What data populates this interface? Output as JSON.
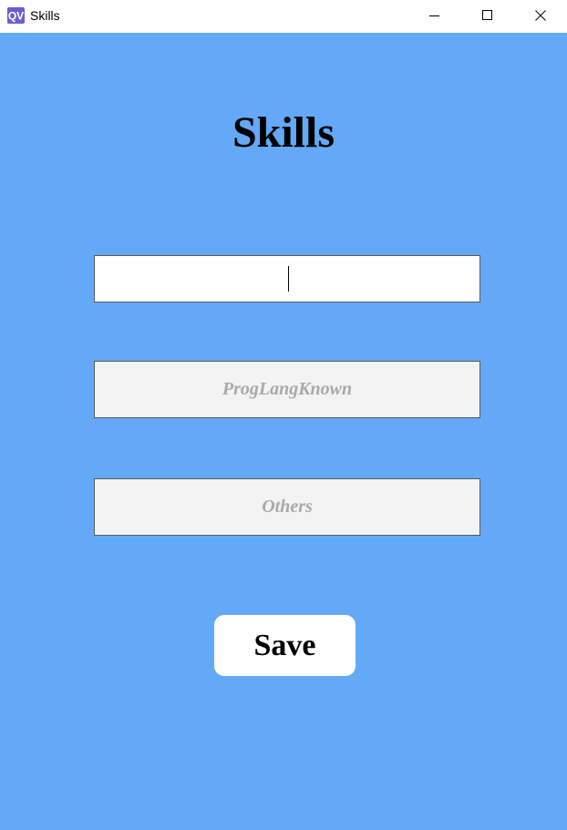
{
  "window": {
    "title": "Skills",
    "icon": "app-icon",
    "controls": [
      "minimize-icon",
      "maximize-icon",
      "close-icon"
    ]
  },
  "form": {
    "heading": "Skills",
    "fields": [
      {
        "value": "",
        "placeholder": ""
      },
      {
        "value": "",
        "placeholder": "ProgLangKnown"
      },
      {
        "value": "",
        "placeholder": "Others"
      }
    ],
    "save_label": "Save"
  },
  "colors": {
    "background": "#63a9f7",
    "field_active": "#ffffff",
    "field_inactive": "#f3f3f3",
    "placeholder_text": "#a9a9a9",
    "button": "#ffffff",
    "app_icon": "#6b5fd1"
  }
}
